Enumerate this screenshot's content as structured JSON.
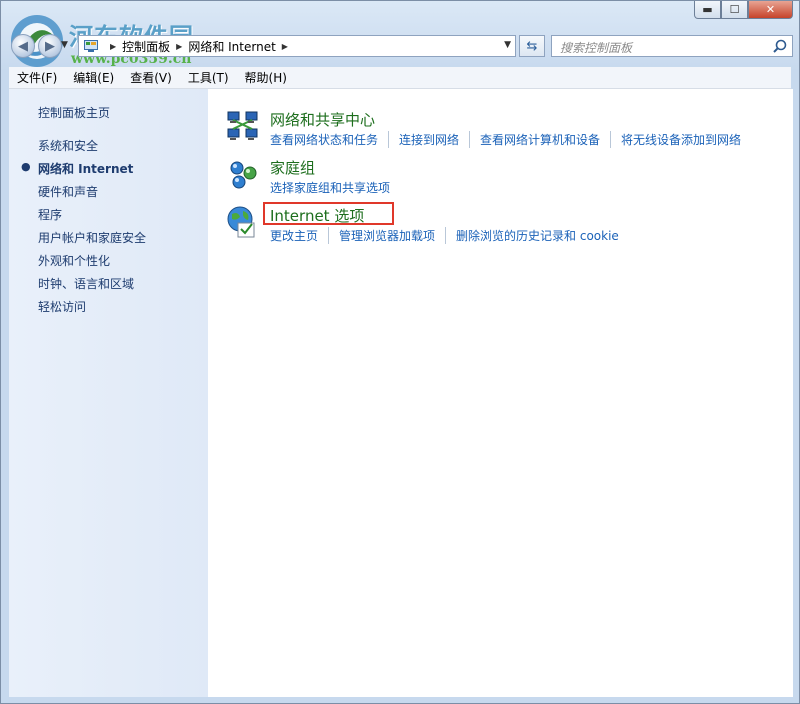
{
  "watermark": {
    "title": "河东软件园",
    "url": "www.pc0359.cn"
  },
  "window": {
    "caption": {
      "minimize": "▬",
      "maximize": "☐",
      "close": "✕"
    }
  },
  "address_bar": {
    "crumbs": [
      "控制面板",
      "网络和 Internet"
    ],
    "search_placeholder": "搜索控制面板"
  },
  "menubar": {
    "items": [
      "文件(F)",
      "编辑(E)",
      "查看(V)",
      "工具(T)",
      "帮助(H)"
    ]
  },
  "sidebar": {
    "home": "控制面板主页",
    "items": [
      "系统和安全",
      "网络和 Internet",
      "硬件和声音",
      "程序",
      "用户帐户和家庭安全",
      "外观和个性化",
      "时钟、语言和区域",
      "轻松访问"
    ],
    "current_index": 1
  },
  "categories": [
    {
      "title": "网络和共享中心",
      "icon": "network-sharing-center-icon",
      "links": [
        "查看网络状态和任务",
        "连接到网络",
        "查看网络计算机和设备",
        "将无线设备添加到网络"
      ]
    },
    {
      "title": "家庭组",
      "icon": "homegroup-icon",
      "links": [
        "选择家庭组和共享选项"
      ]
    },
    {
      "title": "Internet 选项",
      "icon": "internet-options-icon",
      "links": [
        "更改主页",
        "管理浏览器加载项",
        "删除浏览的历史记录和 cookie"
      ],
      "highlighted": true
    }
  ],
  "colors": {
    "category_title": "#1d6e1d",
    "link": "#1b62b8",
    "highlight_box": "#e0382a"
  }
}
